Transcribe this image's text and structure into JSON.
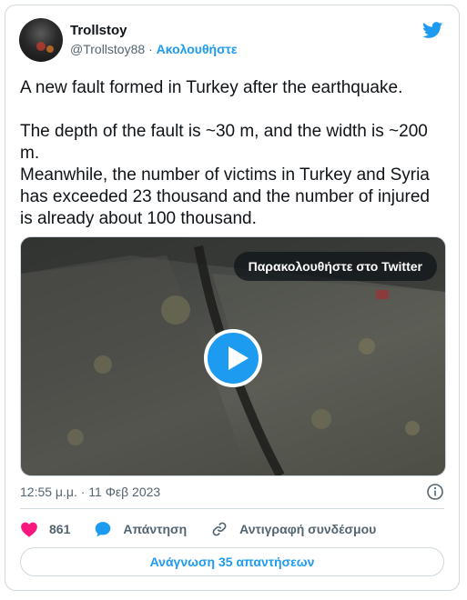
{
  "author": {
    "name": "Trollstoy",
    "handle": "@Trollstoy88",
    "separator": "·",
    "follow_label": "Ακολουθήστε"
  },
  "tweet": {
    "paragraph1": "A new fault formed in Turkey after the earthquake.",
    "paragraph2": "The depth of the fault is ~30 m, and the width is ~200 m.",
    "paragraph3": "Meanwhile, the number of victims in Turkey and Syria has exceeded 23 thousand and the number of injured is already about 100 thousand."
  },
  "media": {
    "watch_label": "Παρακολουθήστε στο Twitter"
  },
  "timestamp": "12:55 μ.μ. · 11 Φεβ 2023",
  "actions": {
    "likes_count": "861",
    "reply_label": "Απάντηση",
    "copy_link_label": "Αντιγραφή συνδέσμου"
  },
  "read_replies_label": "Ανάγνωση 35 απαντήσεων",
  "colors": {
    "accent": "#1d9bf0",
    "like": "#f91880",
    "muted": "#536471"
  },
  "icons": [
    "twitter-bird-icon",
    "play-icon",
    "info-icon",
    "heart-icon",
    "reply-bubble-icon",
    "link-icon"
  ]
}
